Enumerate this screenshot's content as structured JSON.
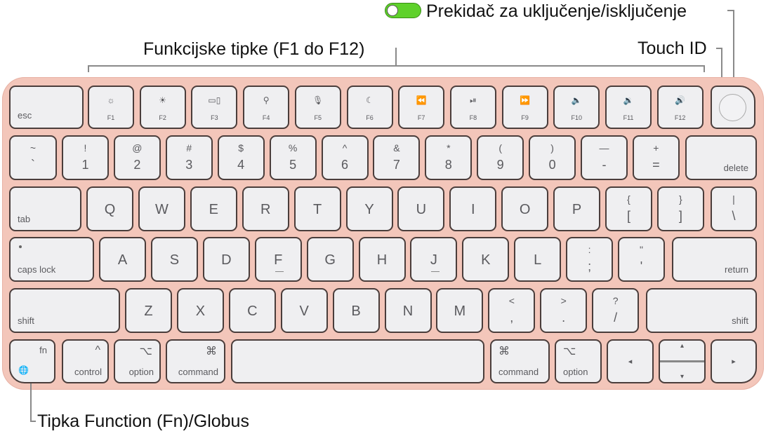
{
  "callouts": {
    "power_switch": "Prekidač za uključenje/isključenje",
    "function_keys": "Funkcijske tipke (F1 do F12)",
    "touch_id": "Touch ID",
    "fn_globe": "Tipka Function (Fn)/Globus"
  },
  "colors": {
    "body": "#f3c6ba",
    "key": "#efeff1",
    "key_border": "#4a3d3b",
    "toggle_on": "#5fd12b"
  },
  "rows": [
    [
      {
        "label": "esc",
        "icon": ""
      },
      {
        "label": "F1",
        "icon": "☼"
      },
      {
        "label": "F2",
        "icon": "☀"
      },
      {
        "label": "F3",
        "icon": "▭▯"
      },
      {
        "label": "F4",
        "icon": "⚲"
      },
      {
        "label": "F5",
        "icon": "🎙"
      },
      {
        "label": "F6",
        "icon": "☾"
      },
      {
        "label": "F7",
        "icon": "⏪"
      },
      {
        "label": "F8",
        "icon": "⏯"
      },
      {
        "label": "F9",
        "icon": "⏩"
      },
      {
        "label": "F10",
        "icon": "🔈"
      },
      {
        "label": "F11",
        "icon": "🔉"
      },
      {
        "label": "F12",
        "icon": "🔊"
      },
      {
        "label": "",
        "icon": "touch-id-sensor"
      }
    ],
    [
      {
        "top": "~",
        "main": "`"
      },
      {
        "top": "!",
        "main": "1"
      },
      {
        "top": "@",
        "main": "2"
      },
      {
        "top": "#",
        "main": "3"
      },
      {
        "top": "$",
        "main": "4"
      },
      {
        "top": "%",
        "main": "5"
      },
      {
        "top": "^",
        "main": "6"
      },
      {
        "top": "&",
        "main": "7"
      },
      {
        "top": "*",
        "main": "8"
      },
      {
        "top": "(",
        "main": "9"
      },
      {
        "top": ")",
        "main": "0"
      },
      {
        "top": "—",
        "main": "-"
      },
      {
        "top": "+",
        "main": "="
      },
      {
        "label": "delete"
      }
    ],
    [
      {
        "label": "tab"
      },
      {
        "main": "Q"
      },
      {
        "main": "W"
      },
      {
        "main": "E"
      },
      {
        "main": "R"
      },
      {
        "main": "T"
      },
      {
        "main": "Y"
      },
      {
        "main": "U"
      },
      {
        "main": "I"
      },
      {
        "main": "O"
      },
      {
        "main": "P"
      },
      {
        "top": "{",
        "main": "["
      },
      {
        "top": "}",
        "main": "]"
      },
      {
        "top": "|",
        "main": "\\"
      }
    ],
    [
      {
        "label": "caps lock"
      },
      {
        "main": "A"
      },
      {
        "main": "S"
      },
      {
        "main": "D"
      },
      {
        "main": "F"
      },
      {
        "main": "G"
      },
      {
        "main": "H"
      },
      {
        "main": "J"
      },
      {
        "main": "K"
      },
      {
        "main": "L"
      },
      {
        "top": ":",
        "main": ";"
      },
      {
        "top": "\"",
        "main": "'"
      },
      {
        "label": "return"
      }
    ],
    [
      {
        "label": "shift"
      },
      {
        "main": "Z"
      },
      {
        "main": "X"
      },
      {
        "main": "C"
      },
      {
        "main": "V"
      },
      {
        "main": "B"
      },
      {
        "main": "N"
      },
      {
        "main": "M"
      },
      {
        "top": "<",
        "main": ","
      },
      {
        "top": ">",
        "main": "."
      },
      {
        "top": "?",
        "main": "/"
      },
      {
        "label": "shift"
      }
    ],
    [
      {
        "label": "fn",
        "icon": "🌐"
      },
      {
        "label": "control",
        "icon": "^"
      },
      {
        "label": "option",
        "icon": "⌥"
      },
      {
        "label": "command",
        "icon": "⌘"
      },
      {
        "label": ""
      },
      {
        "label": "command",
        "icon": "⌘"
      },
      {
        "label": "option",
        "icon": "⌥"
      },
      {
        "label": "",
        "icon": "◂"
      },
      {
        "label": "",
        "icon": "▴",
        "icon2": "▾"
      },
      {
        "label": "",
        "icon": "▸"
      }
    ]
  ]
}
